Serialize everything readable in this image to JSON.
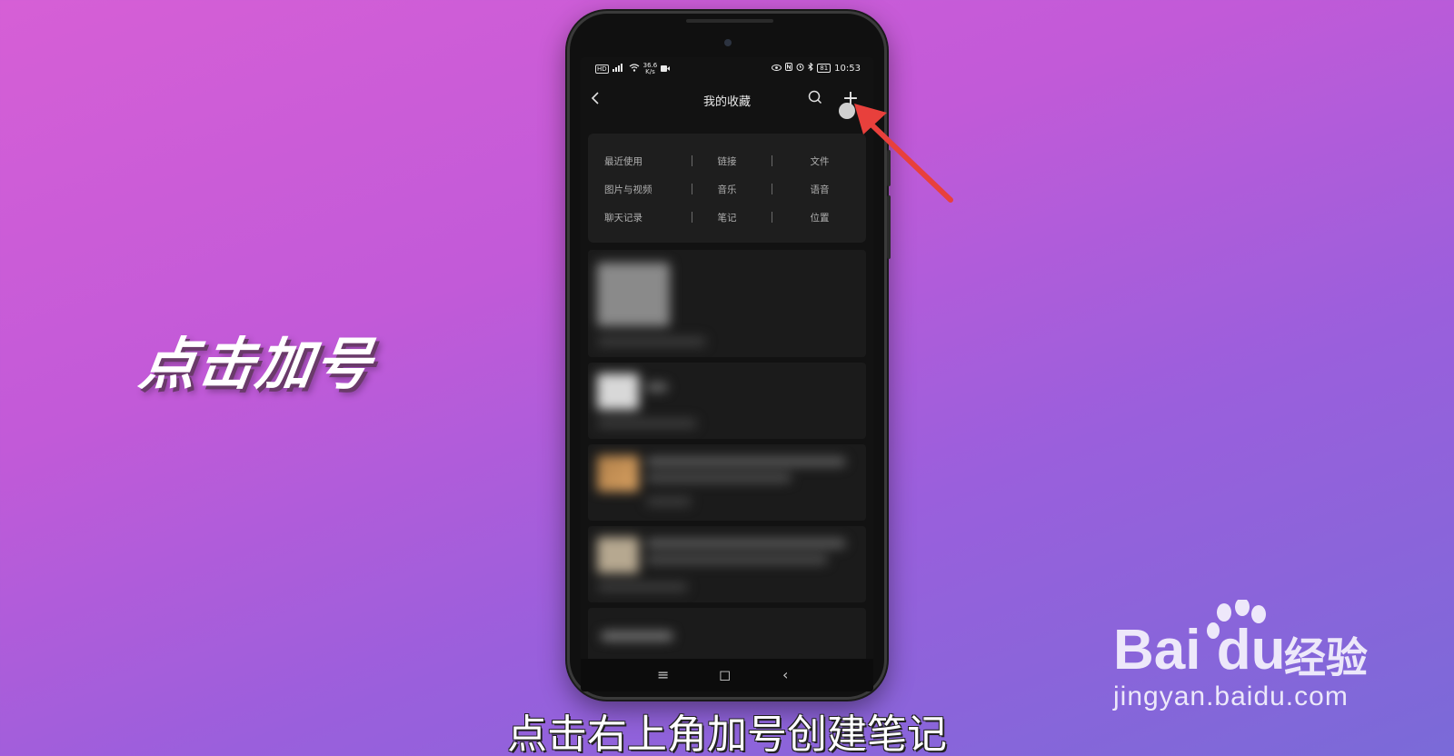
{
  "overlay": {
    "side_caption": "点击加号",
    "subtitle": "点击右上角加号创建笔记",
    "watermark": {
      "logo": "Bai du",
      "chinese": "经验",
      "url": "jingyan.baidu.com"
    },
    "arrow_color": "#e8403c"
  },
  "status_bar": {
    "left": [
      "HD",
      "4G",
      "wifi-icon",
      "36.6 K/s",
      "video-icon"
    ],
    "net_speed_top": "36.6",
    "net_speed_bottom": "K/s",
    "right_icons": [
      "eye-icon",
      "nfc-icon",
      "alarm-icon",
      "bluetooth-icon"
    ],
    "battery": "81",
    "time": "10:53"
  },
  "nav": {
    "title": "我的收藏",
    "back_icon": "chevron-left-icon",
    "search_icon": "search-icon",
    "add_label": "+"
  },
  "categories": [
    [
      "最近使用",
      "链接",
      "文件"
    ],
    [
      "图片与视频",
      "音乐",
      "语音"
    ],
    [
      "聊天记录",
      "笔记",
      "位置"
    ]
  ],
  "system_nav": {
    "menu": "≡",
    "home": "◻",
    "back": "‹"
  }
}
